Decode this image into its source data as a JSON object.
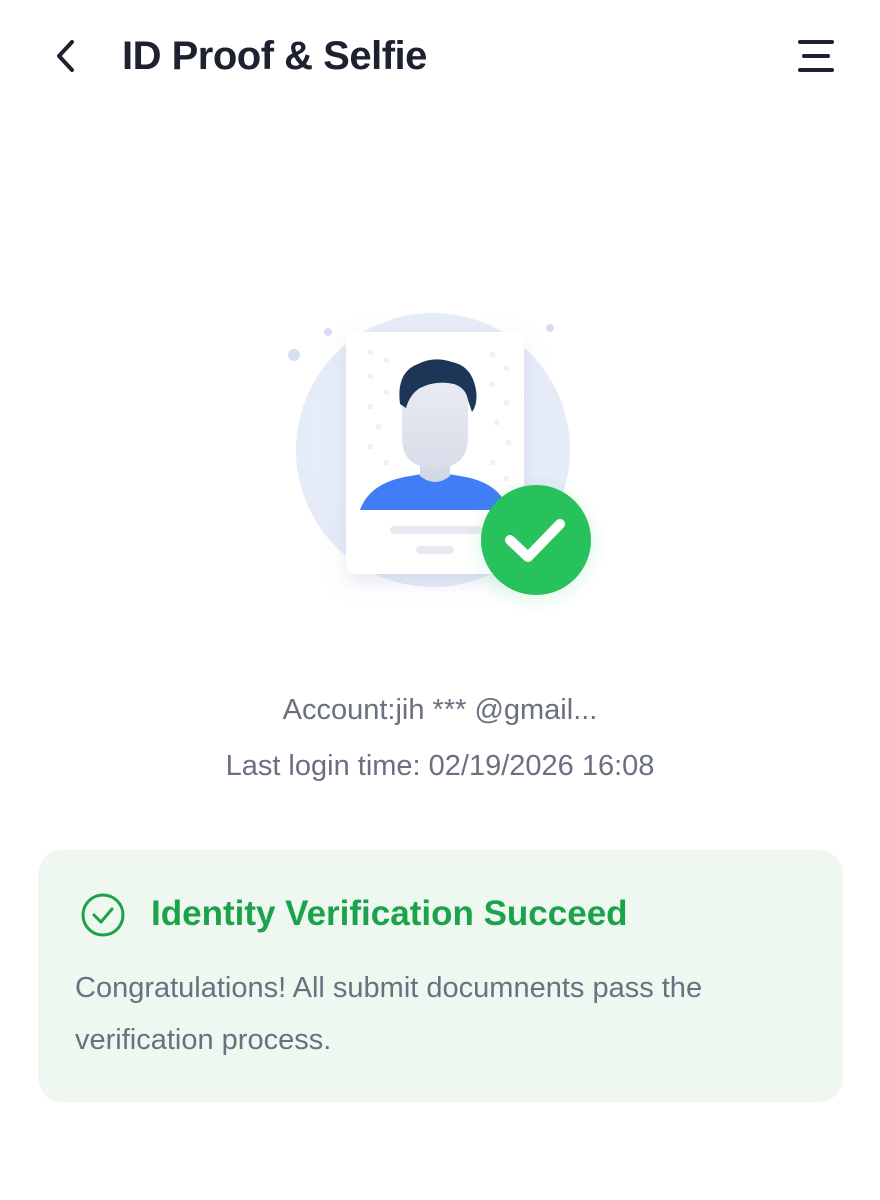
{
  "header": {
    "title": "ID Proof & Selfie",
    "back_icon": "chevron-left-icon",
    "menu_icon": "hamburger-menu-icon"
  },
  "illustration": {
    "icon": "verified-id-card-illustration",
    "status_icon": "check-circle-icon"
  },
  "account": {
    "account_text": "Account:jih *** @gmail...",
    "last_login_text": "Last login time: 02/19/2026 16:08"
  },
  "verification": {
    "title": "Identity Verification Succeed",
    "description": "Congratulations! All submit documnents pass the verification process.",
    "icon": "check-circle-outline-icon"
  },
  "colors": {
    "success": "#1aa34a",
    "card_background": "#eef8f1",
    "text_primary": "#1e2230",
    "text_secondary": "#6b7080",
    "avatar_shirt": "#3f7ef6",
    "avatar_hair": "#1d3557"
  }
}
